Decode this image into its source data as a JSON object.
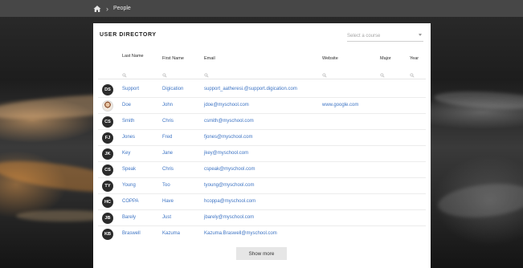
{
  "breadcrumb": {
    "current": "People"
  },
  "directory": {
    "title": "USER DIRECTORY",
    "course_select": {
      "placeholder": "Select a course"
    },
    "columns": {
      "last_name": "Last Name",
      "first_name": "First Name",
      "email": "Email",
      "website": "Website",
      "major": "Major",
      "year": "Year"
    },
    "rows": [
      {
        "initials": "DS",
        "last": "Support",
        "first": "Digication",
        "email": "support_aatheresi.@support.digication.com",
        "website": ""
      },
      {
        "initials": "",
        "last": "Doe",
        "first": "John",
        "email": "jdoe@myschool.com",
        "website": "www.google.com"
      },
      {
        "initials": "CS",
        "last": "Smith",
        "first": "Chris",
        "email": "csmith@myschool.com",
        "website": ""
      },
      {
        "initials": "FJ",
        "last": "Jones",
        "first": "Fred",
        "email": "fjones@myschool.com",
        "website": ""
      },
      {
        "initials": "JK",
        "last": "Key",
        "first": "Jane",
        "email": "jkey@myschool.com",
        "website": ""
      },
      {
        "initials": "CS",
        "last": "Speak",
        "first": "Chris",
        "email": "cspeak@myschool.com",
        "website": ""
      },
      {
        "initials": "TY",
        "last": "Young",
        "first": "Too",
        "email": "tyoung@myschool.com",
        "website": ""
      },
      {
        "initials": "HC",
        "last": "COPPA",
        "first": "Have",
        "email": "hcoppa@myschool.com",
        "website": ""
      },
      {
        "initials": "JB",
        "last": "Barely",
        "first": "Just",
        "email": "jbarely@myschool.com",
        "website": ""
      },
      {
        "initials": "KB",
        "last": "Braswell",
        "first": "Kazuma",
        "email": "Kazuma.Braswell@myschool.com",
        "website": ""
      }
    ],
    "show_more_label": "Show more"
  },
  "icons": {
    "home": "home-icon",
    "breadcrumb_separator": "chevron-right-icon",
    "filter": "search-icon",
    "select": "chevron-down-icon"
  },
  "colors": {
    "link": "#3d74c4",
    "topbar": "#474747",
    "avatar": "#2b2b2b"
  }
}
